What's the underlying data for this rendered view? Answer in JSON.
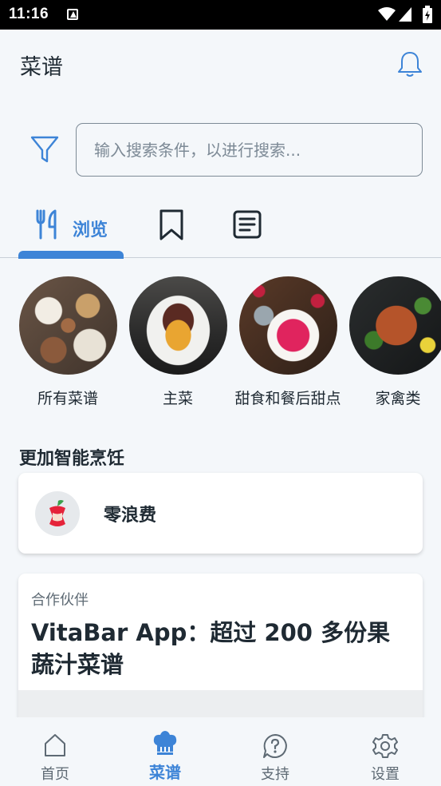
{
  "status_bar": {
    "time": "11:16"
  },
  "header": {
    "title": "菜谱"
  },
  "search": {
    "placeholder": "输入搜索条件，以进行搜索..."
  },
  "tabs": [
    {
      "label": "浏览",
      "icon": "fork-knife-icon",
      "active": true
    },
    {
      "label": "",
      "icon": "bookmark-icon",
      "active": false
    },
    {
      "label": "",
      "icon": "list-document-icon",
      "active": false
    }
  ],
  "categories": [
    {
      "label": "所有菜谱"
    },
    {
      "label": "主菜"
    },
    {
      "label": "甜食和餐后甜点"
    },
    {
      "label": "家禽类"
    }
  ],
  "section": {
    "title": "更加智能烹饪"
  },
  "zero_waste_card": {
    "title": "零浪费",
    "icon": "apple-core-icon"
  },
  "partner_card": {
    "kicker": "合作伙伴",
    "headline": "VitaBar App：超过 200 多份果蔬汁菜谱"
  },
  "bottom_nav": [
    {
      "label": "首页",
      "icon": "home-icon"
    },
    {
      "label": "菜谱",
      "icon": "chef-hat-icon"
    },
    {
      "label": "支持",
      "icon": "help-icon"
    },
    {
      "label": "设置",
      "icon": "gear-icon"
    }
  ],
  "colors": {
    "accent": "#3d84d7",
    "background": "#f4f7fa",
    "text": "#1f2a33"
  }
}
